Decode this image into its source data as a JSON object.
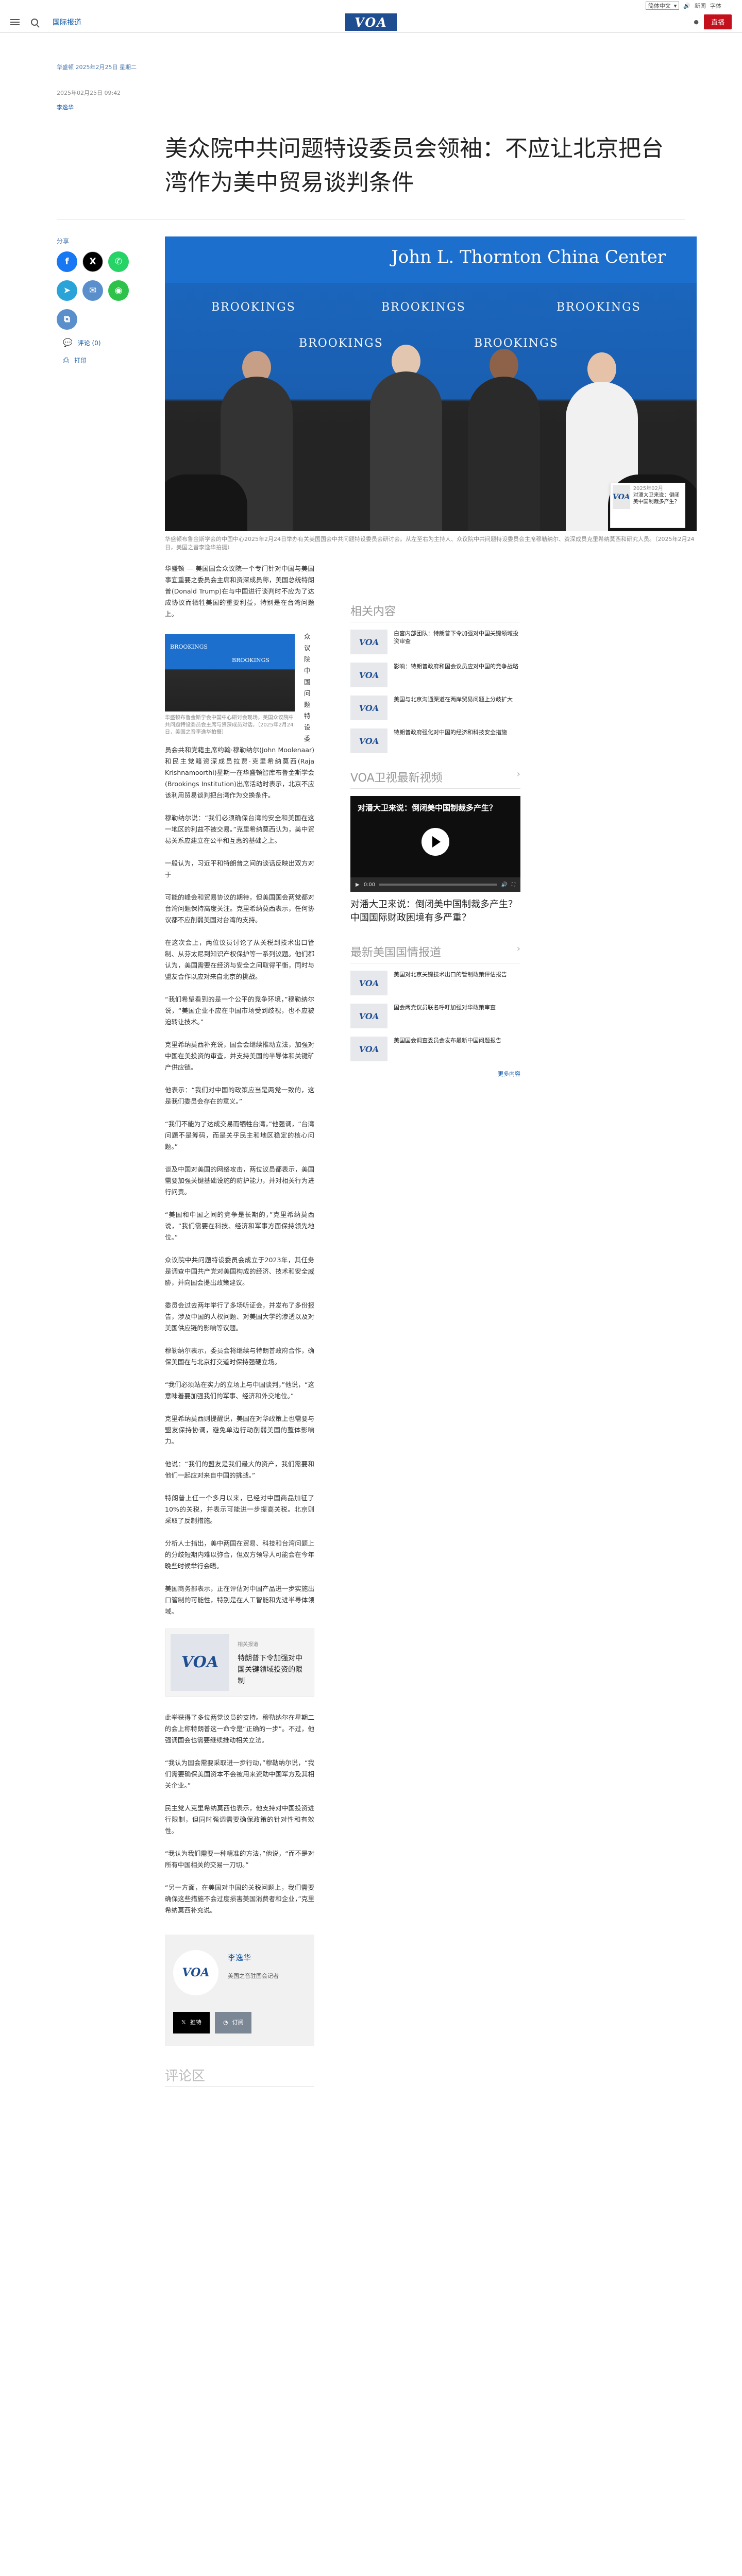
{
  "util": {
    "language": "简体中文",
    "listen_label": "新闻",
    "font_label": "字体",
    "search_label": ""
  },
  "header": {
    "section": "国际报道",
    "logo": "VOA",
    "live_label": "直播"
  },
  "meta": {
    "published": "华盛顿 2025年2月25日 星期二",
    "updated": "",
    "dateline": "2025年02月25日 09:42",
    "author_tag": "李逸华"
  },
  "title": "美众院中共问题特设委员会领袖：不应让北京把台湾作为美中贸易谈判条件",
  "share": {
    "label": "分享",
    "comments": "评论 (0)",
    "print": "打印"
  },
  "hero": {
    "center_name": "John L. Thornton China Center",
    "brand": "BROOKINGS",
    "caption": "华盛顿布鲁金斯学会的中国中心2025年2月24日举办有关美国国会中共问题特设委员会研讨会。从左至右为主持人、众议院中共问题特设委员会主席穆勒纳尔、资深成员克里希纳莫西和研究人员。（2025年2月24日，美国之音李逸华拍摄）"
  },
  "floating": {
    "date": "2025年02月",
    "text": "对潘大卫来说：倒闭美中国制裁多产生？"
  },
  "inline_fig": {
    "brand": "BROOKINGS",
    "caption": "华盛顿布鲁金斯学会中国中心研讨会现场。美国众议院中共问题特设委员会主席与资深成员对话。（2025年2月24日，美国之音李逸华拍摄）"
  },
  "article": {
    "p1": "华盛顿 — 美国国会众议院一个专门针对中国与美国事宜重要之委员会主席和资深成员称，美国总统特朗普(Donald Trump)在与中国进行谈判时不应为了达成协议而牺牲美国的重要利益，特别是在台湾问题上。",
    "p2": "众议院中国问题特设委员会共和党籍主席约翰·穆勒纳尔(John Moolenaar)和民主党籍资深成员拉贾·克里希纳莫西(Raja Krishnamoorthi)星期一在华盛顿智库布鲁金斯学会(Brookings Institution)出席活动时表示，北京不应该利用贸易谈判把台湾作为交换条件。",
    "p3": "穆勒纳尔说：“我们必须确保台湾的安全和美国在这一地区的利益不被交易。”克里希纳莫西认为，美中贸易关系应建立在公平和互惠的基础之上。",
    "p4": "一般认为，习近平和特朗普之间的谈话反映出双方对于",
    "p5": "可能的峰会和贸易协议的期待，但美国国会两党都对台湾问题保持高度关注。克里希纳莫西表示，任何协议都不应削弱美国对台湾的支持。",
    "p6": "在这次会上，两位议员讨论了从关税到技术出口管制、从芬太尼到知识产权保护等一系列议题。他们都认为，美国需要在经济与安全之间取得平衡，同时与盟友合作以应对来自北京的挑战。",
    "p7": "“我们希望看到的是一个公平的竞争环境，”穆勒纳尔说，“美国企业不应在中国市场受到歧视，也不应被迫转让技术。”",
    "p8": "克里希纳莫西补充说，国会会继续推动立法，加强对中国在美投资的审查，并支持美国的半导体和关键矿产供应链。",
    "p9": "他表示：“我们对中国的政策应当是两党一致的，这是我们委员会存在的意义。”",
    "p10": "“我们不能为了达成交易而牺牲台湾，”他强调，“台湾问题不是筹码，而是关乎民主和地区稳定的核心问题。”",
    "p11": "谈及中国对美国的网络攻击，两位议员都表示，美国需要加强关键基础设施的防护能力，并对相关行为进行问责。",
    "p12": "“美国和中国之间的竞争是长期的，”克里希纳莫西说，“我们需要在科技、经济和军事方面保持领先地位。”",
    "p13": "众议院中共问题特设委员会成立于2023年，其任务是调查中国共产党对美国构成的经济、技术和安全威胁，并向国会提出政策建议。",
    "p14": "委员会过去两年举行了多场听证会，并发布了多份报告，涉及中国的人权问题、对美国大学的渗透以及对美国供应链的影响等议题。",
    "p15": "穆勒纳尔表示，委员会将继续与特朗普政府合作，确保美国在与北京打交道时保持强硬立场。",
    "p16": "“我们必须站在实力的立场上与中国谈判，”他说，“这意味着要加强我们的军事、经济和外交地位。”",
    "p17": "克里希纳莫西则提醒说，美国在对华政策上也需要与盟友保持协调，避免单边行动削弱美国的整体影响力。",
    "p18": "他说：“我们的盟友是我们最大的资产，我们需要和他们一起应对来自中国的挑战。”",
    "p19": "特朗普上任一个多月以来，已经对中国商品加征了10%的关税，并表示可能进一步提高关税。北京则采取了反制措施。",
    "p20": "分析人士指出，美中两国在贸易、科技和台湾问题上的分歧短期内难以弥合，但双方领导人可能会在今年晚些时候举行会晤。",
    "p21": "美国商务部表示，正在评估对中国产品进一步实施出口管制的可能性，特别是在人工智能和先进半导体领域。"
  },
  "related": {
    "label": "相关报道",
    "title": "特朗普下令加强对中国关键领域投资的限制"
  },
  "article2": {
    "p1": "此举获得了多位两党议员的支持。穆勒纳尔在星期二的会上称特朗普这一命令是“正确的一步”。不过，他强调国会也需要继续推动相关立法。",
    "p2": "“我认为国会需要采取进一步行动，”穆勒纳尔说，“我们需要确保美国资本不会被用来资助中国军方及其相关企业。”",
    "p3": "民主党人克里希纳莫西也表示，他支持对中国投资进行限制，但同时强调需要确保政策的针对性和有效性。",
    "p4": "“我认为我们需要一种精准的方法，”他说，“而不是对所有中国相关的交易一刀切。”",
    "p5": "“另一方面，在美国对中国的关税问题上，我们需要确保这些措施不会过度损害美国消费者和企业，”克里希纳莫西补充说。"
  },
  "author_box": {
    "name": "李逸华",
    "role": "美国之音驻国会记者",
    "x_label": "推特",
    "rss_label": "订阅"
  },
  "comments_title": "评论区",
  "sidebar": {
    "related_title": "相关内容",
    "related": [
      "白宫内部团队：特朗普下令加强对中国关键领域投资审查",
      "影响：特朗普政府和国会议员应对中国的竞争战略",
      "美国与北京沟通渠道在两岸贸易问题上分歧扩大",
      "特朗普政府强化对中国的经济和科技安全措施"
    ],
    "video_title": "VOA卫视最新视频",
    "video_overlay": "对潘大卫来说：倒闭美中国制裁多产生？",
    "video_time": "0:00",
    "video_caption": "对潘大卫来说：倒闭美中国制裁多产生？中国国际财政困境有多严重？",
    "latest_title": "最新美国国情报道",
    "latest": [
      "美国对北京关键技术出口的管制政策评估报告",
      "国会两党议员联名呼吁加强对华政策审查",
      "美国国会调查委员会发布最新中国问题报告"
    ],
    "more_label": "更多内容"
  }
}
